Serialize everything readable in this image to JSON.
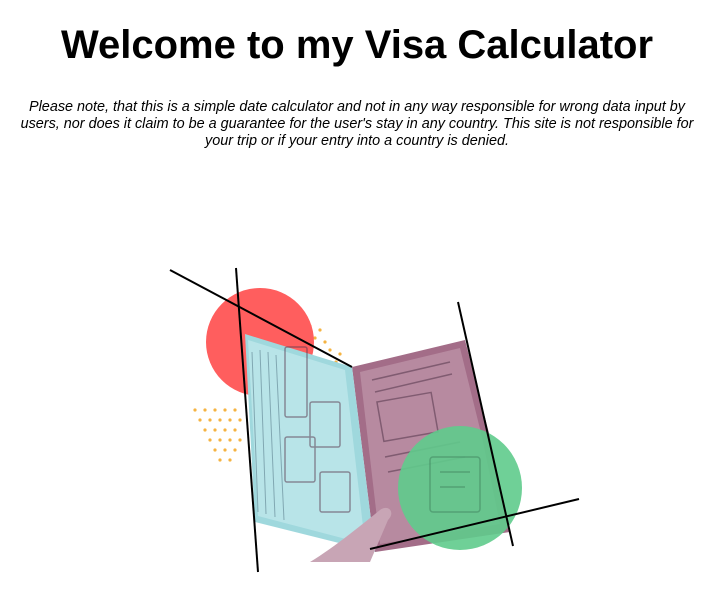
{
  "page": {
    "title": "Welcome to my Visa Calculator",
    "disclaimer": "Please note, that this is a simple date calculator and not in any way responsible for wrong data input by users, nor does it claim to be a guarantee for the user's stay in any country. This site is not responsible for your trip or if your entry into a country is denied."
  },
  "hero": {
    "icon": "passport-illustration",
    "colors": {
      "red_circle": "#ff5e5e",
      "green_circle": "#5fcb8c",
      "dots": "#f5b342",
      "pages": "#9fd8dd",
      "cover": "#a06a85",
      "lines": "#000000"
    }
  }
}
